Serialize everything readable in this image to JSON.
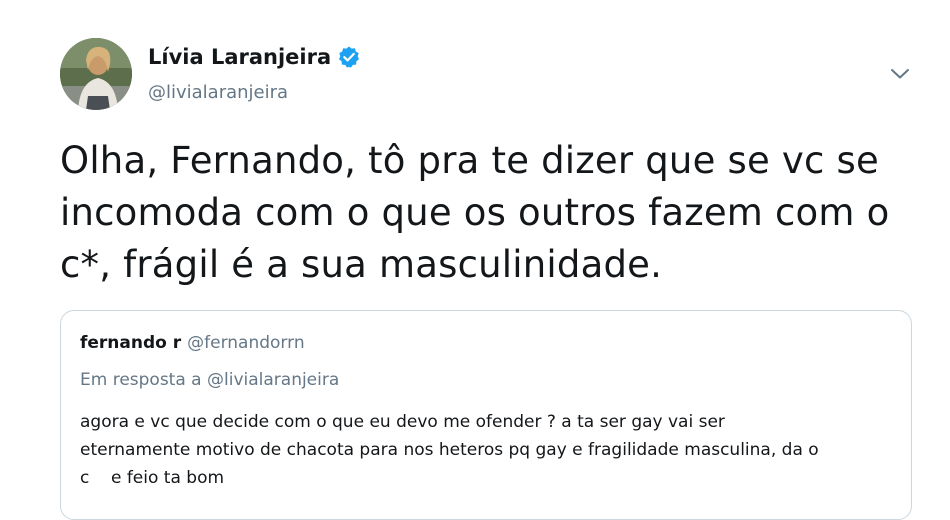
{
  "author": {
    "display_name": "Lívia Laranjeira",
    "handle": "@livialaranjeira",
    "verified": true,
    "verified_color": "#1da1f2"
  },
  "icons": {
    "verified": "verified-badge-icon",
    "caret": "chevron-down-icon"
  },
  "tweet": {
    "lines": [
      "Olha, Fernando, tô pra te dizer que se vc se",
      "incomoda com o que os outros fazem com o",
      "c*, frágil é a sua masculinidade."
    ]
  },
  "quoted_tweet": {
    "display_name": "fernando r",
    "handle": "@fernandorrn",
    "reply_to": "Em resposta a @livialaranjeira",
    "lines": [
      "agora e vc que decide com o que eu devo me ofender ? a ta ser gay vai ser",
      "eternamente motivo de chacota para nos heteros pq gay e fragilidade masculina, da o",
      "c    e feio ta bom"
    ]
  },
  "colors": {
    "text": "#14171a",
    "secondary": "#657786",
    "border": "#ccd6dd"
  }
}
